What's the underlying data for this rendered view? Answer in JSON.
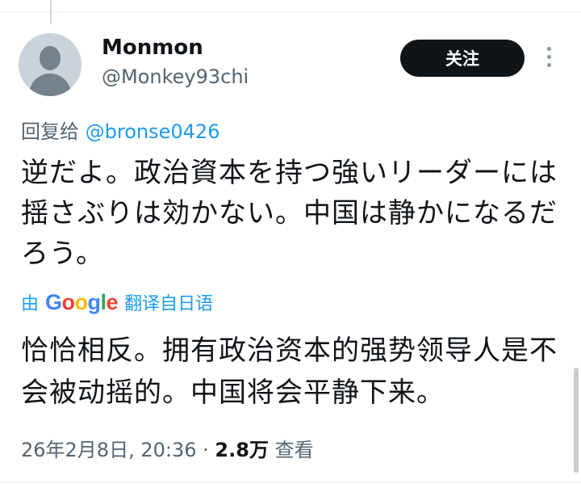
{
  "tweet": {
    "display_name": "Monmon",
    "handle": "@Monkey93chi",
    "follow_label": "关注",
    "reply_prefix": "回复给",
    "reply_mention": "@bronse0426",
    "text": "逆だよ。政治資本を持つ強いリーダーには揺さぶりは効かない。中国は静かになるだろう。",
    "translation": {
      "prefix": "由",
      "provider": "Google",
      "suffix": "翻译自日语",
      "text": "恰恰相反。拥有政治资本的强势领导人是不会被动摇的。中国将会平静下来。"
    },
    "meta": {
      "timestamp": "26年2月8日, 20:36",
      "separator": "·",
      "views_count": "2.8万",
      "views_label": "查看"
    }
  },
  "icons": {
    "avatar": "default-avatar-icon",
    "more": "more-vertical-icon"
  },
  "colors": {
    "link": "#1d9bf0",
    "follow_button": "#0f1419",
    "secondary_text": "#536471"
  }
}
